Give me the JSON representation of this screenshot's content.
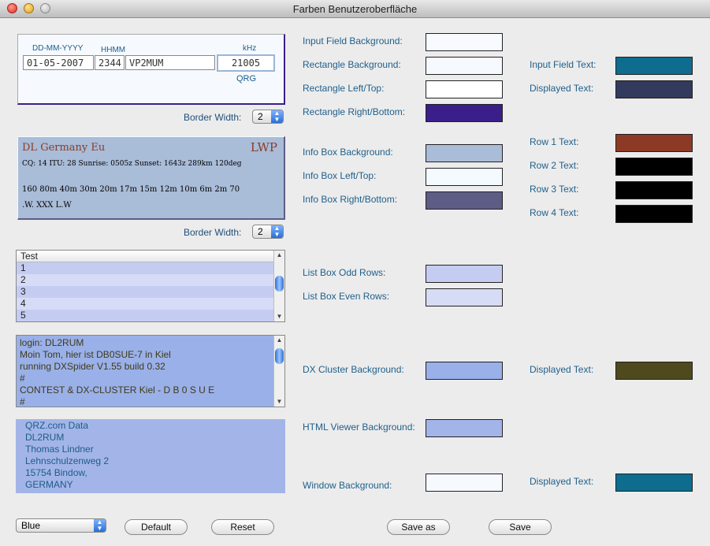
{
  "window": {
    "title": "Farben Benutzeroberfläche"
  },
  "input_preview": {
    "date_header": "DD-MM-YYYY",
    "time_header": "HHMM",
    "freq_header": "kHz",
    "date_value": "01-05-2007",
    "time_value": "2344",
    "call_value": "VP2MUM",
    "freq_value": "21005",
    "qrg_label": "QRG"
  },
  "border_width_1": {
    "label": "Border Width:",
    "value": "2"
  },
  "info_box": {
    "line1_left": "DL  Germany  Eu",
    "line1_right": "LWP",
    "line2": "CQ: 14  ITU: 28  Sunrise: 0505z  Sunset: 1643z      289km  120deg",
    "line3": "160  80m  40m  30m  20m  17m  15m  12m  10m     6m     2m  70",
    "line4": ".W.  XXX  L.W"
  },
  "border_width_2": {
    "label": "Border Width:",
    "value": "2"
  },
  "list_box": {
    "header": "Test",
    "rows": [
      "1",
      "2",
      "3",
      "4",
      "5"
    ]
  },
  "dx_cluster": {
    "lines": [
      "login: DL2RUM",
      "Moin Tom, hier ist DB0SUE-7 in Kiel",
      "running DXSpider V1.55 build 0.32",
      "#",
      "CONTEST & DX-CLUSTER Kiel - D B 0 S U E",
      "#"
    ]
  },
  "html_viewer": {
    "lines": [
      "QRZ.com Data",
      "DL2RUM",
      "Thomas Lindner",
      "Lehnschulzenweg 2",
      "15754 Bindow,",
      "GERMANY"
    ]
  },
  "color_labels": {
    "input_field_bg": "Input Field Background:",
    "rect_bg": "Rectangle Background:",
    "rect_left_top": "Rectangle Left/Top:",
    "rect_right_bottom": "Rectangle Right/Bottom:",
    "info_bg": "Info Box Background:",
    "info_left_top": "Info Box Left/Top:",
    "info_right_bottom": "Info Box Right/Bottom:",
    "list_odd": "List Box Odd Rows:",
    "list_even": "List Box Even Rows:",
    "dx_bg": "DX Cluster Background:",
    "html_bg": "HTML Viewer Background:",
    "window_bg": "Window Background:",
    "input_field_text": "Input Field Text:",
    "displayed_text_1": "Displayed Text:",
    "row1": "Row 1 Text:",
    "row2": "Row 2 Text:",
    "row3": "Row 3 Text:",
    "row4": "Row 4 Text:",
    "displayed_text_dx": "Displayed Text:",
    "displayed_text_window": "Displayed Text:"
  },
  "colors": {
    "input_field_bg": "#f7fbff",
    "rect_bg": "#f6faff",
    "rect_left_top": "#ffffff",
    "rect_right_bottom": "#3a1f8a",
    "info_bg": "#a9bcd8",
    "info_left_top": "#f4faff",
    "info_right_bottom": "#5d5c86",
    "list_odd": "#c4ccf2",
    "list_even": "#d6dcf5",
    "dx_bg": "#9ab0e8",
    "html_bg": "#a3b5e8",
    "window_bg": "#f6faff",
    "input_field_text": "#0e6c8e",
    "displayed_text_1": "#323a5e",
    "row1": "#8c3a26",
    "row2": "#000000",
    "row3": "#000000",
    "row4": "#000000",
    "displayed_text_dx": "#4e4a1e",
    "displayed_text_window": "#0e6c8e"
  },
  "bottom": {
    "scheme_value": "Blue",
    "default_label": "Default",
    "reset_label": "Reset",
    "save_as_label": "Save as",
    "save_label": "Save"
  }
}
